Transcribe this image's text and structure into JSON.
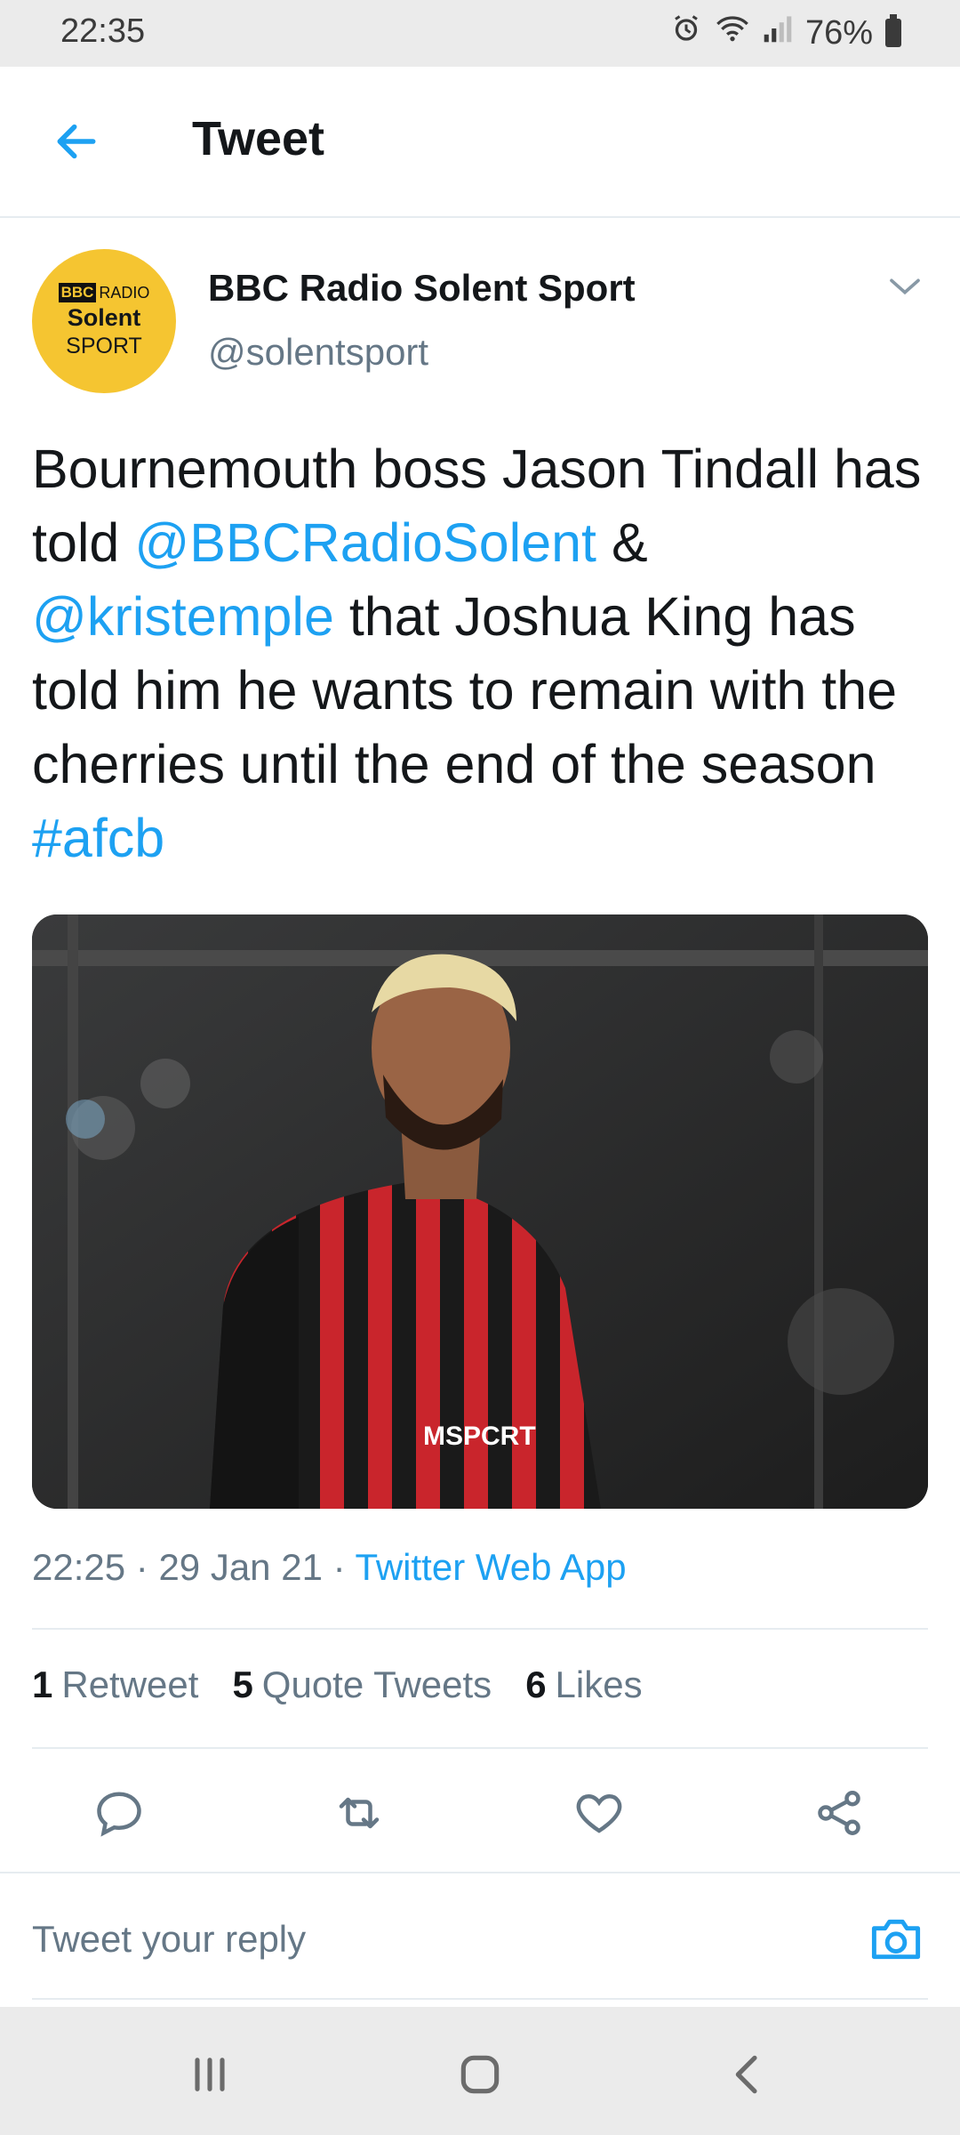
{
  "status_bar": {
    "time": "22:35",
    "battery": "76%"
  },
  "app_bar": {
    "title": "Tweet"
  },
  "tweet": {
    "author_name": "BBC Radio Solent Sport",
    "handle": "@solentsport",
    "avatar": {
      "bbc": "BBC",
      "radio": "RADIO",
      "station": "Solent",
      "sport": "SPORT"
    },
    "text": {
      "part1": "Bournemouth boss Jason Tindall has told ",
      "mention1": "@BBCRadioSolent",
      "part2": " & ",
      "mention2": "@kristemple",
      "part3": " that Joshua King has told him he wants to remain with the cherries until the end of the season ",
      "hashtag": "#afcb"
    },
    "meta": {
      "time": "22:25",
      "date": "29 Jan 21",
      "source": "Twitter Web App",
      "sep": " · "
    },
    "stats": {
      "retweets_count": "1",
      "retweets_label": "Retweet",
      "quotes_count": "5",
      "quotes_label": "Quote Tweets",
      "likes_count": "6",
      "likes_label": "Likes"
    },
    "photo": {
      "shirt_text": "MSPCRT"
    }
  },
  "reply": {
    "placeholder": "Tweet your reply"
  },
  "colors": {
    "accent": "#1da1f2",
    "muted": "#657786",
    "text": "#14171a",
    "avatar_bg": "#f5c531"
  }
}
